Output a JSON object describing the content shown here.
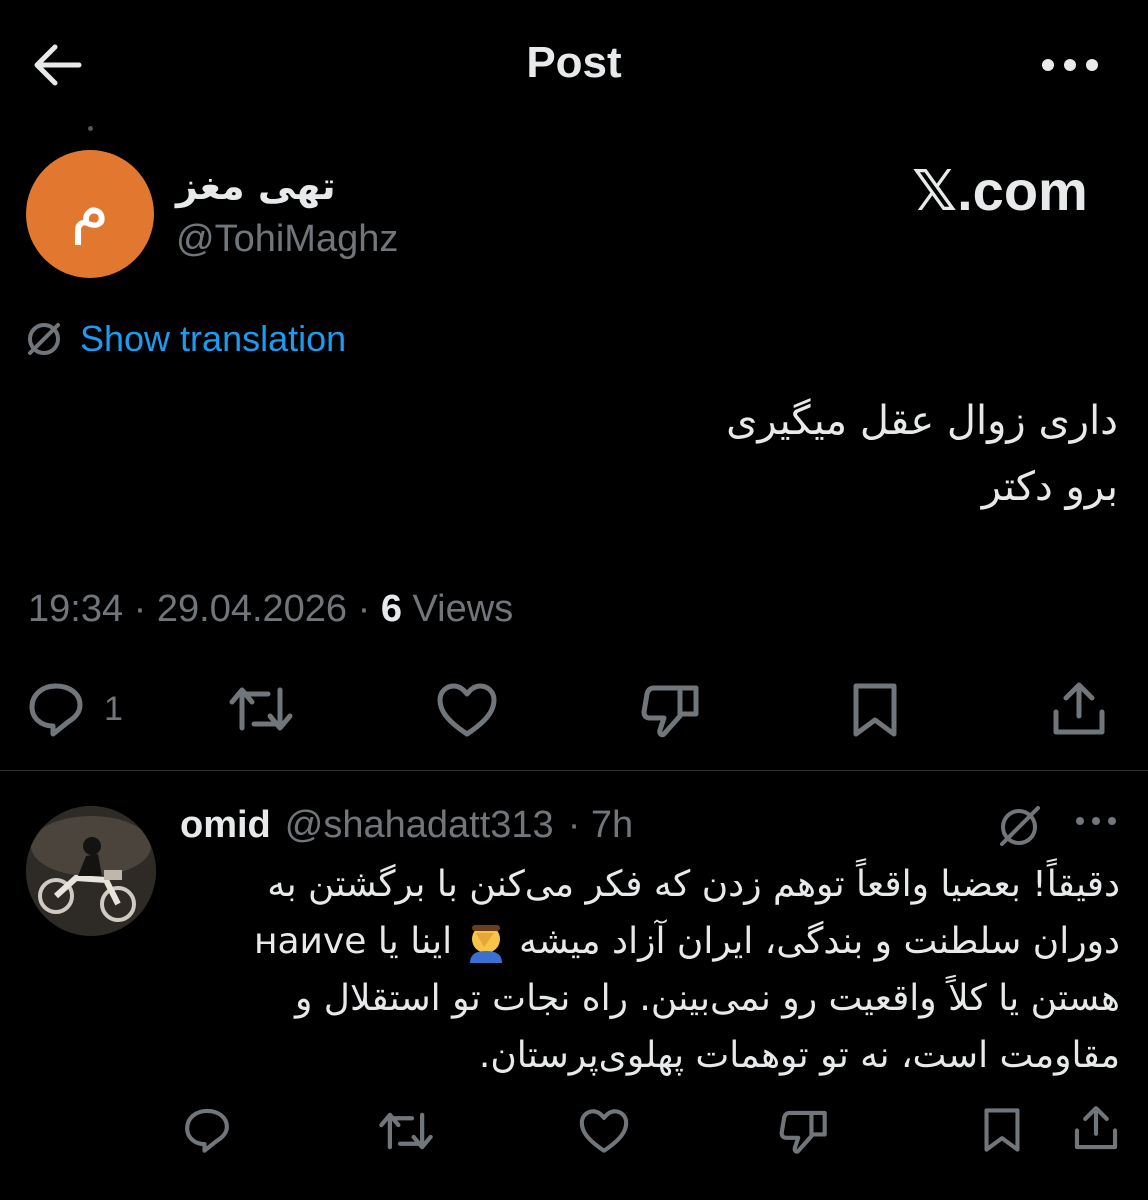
{
  "header": {
    "title": "Post",
    "back_icon": "arrow-left-icon",
    "more_icon": "more-horizontal-icon"
  },
  "post": {
    "author": {
      "avatar_letter": "م",
      "avatar_color": "#e2782f",
      "name": "تهی مغز",
      "handle": "@TohiMaghz"
    },
    "watermark": "𝕏.com",
    "translate_label": "Show translation",
    "text": "داری زوال عقل میگیری\nبرو دکتر",
    "time": "19:34 · 29.04.2026 · ",
    "views_count": "6",
    "views_label": " Views",
    "actions": {
      "reply_count": "1"
    }
  },
  "reply": {
    "name": "omid",
    "handle": "@shahadatt313",
    "time": "· 7h",
    "text_part1": "دقیقاً! بعضیا واقعاً توهم زدن که فکر می‌کنن با برگشتن به دوران سلطنت و بندگی، ایران آزاد میشه",
    "text_part2": "اینا یا наиve هستن یا کلاً واقعیت رو نمی‌بینن. راه نجات تو استقلال و مقاومت است، نه تو توهمات پهلوی‌پرستان."
  },
  "colors": {
    "accent": "#1d9bf0",
    "muted": "#71767b",
    "text": "#e7e9ea",
    "background": "#000000"
  }
}
